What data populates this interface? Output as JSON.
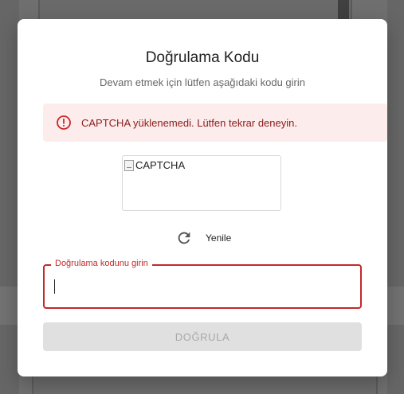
{
  "dialog": {
    "title": "Doğrulama Kodu",
    "subtitle": "Devam etmek için lütfen aşağıdaki kodu girin"
  },
  "alert": {
    "icon": "error-circle-icon",
    "message": "CAPTCHA yüklenemedi. Lütfen tekrar deneyin.",
    "color": "#c62828",
    "background": "#fdecec"
  },
  "captcha": {
    "alt_text": "CAPTCHA",
    "icon": "broken-image-icon"
  },
  "refresh": {
    "icon": "refresh-icon",
    "label": "Yenile"
  },
  "code_field": {
    "label": "Doğrulama kodunu girin",
    "value": "",
    "border_color": "#c62828"
  },
  "verify_button": {
    "label": "DOĞRULA",
    "disabled": true
  }
}
